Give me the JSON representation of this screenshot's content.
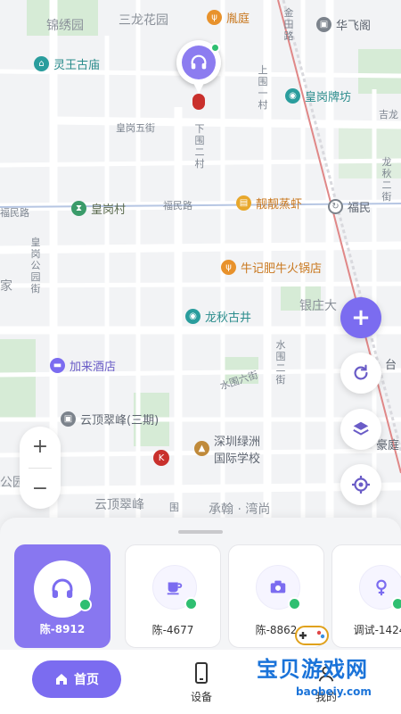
{
  "map": {
    "areas": {
      "jinxiu": "锦绣园",
      "sanlong": "三龙花园",
      "jia": "家",
      "gongyuan": "公园",
      "yinzhuang": "银庄大",
      "yunding_bottom": "云顶翠峰",
      "chenghan": "承翰 · 湾尚",
      "shantai": "台",
      "ji": "吉龙"
    },
    "roads": {
      "jinhuan": "金田路",
      "shangweiyi": "上围一村",
      "huanggang5": "皇岗五街",
      "xiawei": "下围二村",
      "fumin_left": "福民路",
      "fumin_mid": "福民路",
      "huanggang_park": "皇岗公园街",
      "longqiu": "龙秋二街",
      "shuiwei6": "水围六街",
      "shuiwei2": "水围二街",
      "wei": "围"
    },
    "pois": {
      "lingwang": "灵王古庙",
      "lu": "胤庭",
      "huafei": "华飞阁",
      "huanggang_paifang": "皇岗牌坊",
      "huanggangcun": "皇岗村",
      "liangliang": "靓靓蒸虾",
      "fumin": "福民",
      "niuji": "牛记肥牛火锅店",
      "longqiu_well": "龙秋古井",
      "jialai": "加来酒店",
      "yunding": "云顶翠峰(三期)",
      "shenzhen_school": "深圳绿洲",
      "shenzhen_school2": "国际学校",
      "haoting": "豪庭"
    }
  },
  "controls": {
    "zoom_in": "+",
    "zoom_out": "−",
    "add": "+"
  },
  "devices": [
    {
      "name": "陈-8912",
      "icon": "headphones-icon",
      "active": true
    },
    {
      "name": "陈-4677",
      "icon": "cup-icon",
      "active": false
    },
    {
      "name": "陈-8862",
      "icon": "camera-icon",
      "active": false
    },
    {
      "name": "调试-1424",
      "icon": "female-icon",
      "active": false
    }
  ],
  "nav": {
    "home": "首页",
    "device": "设备",
    "mine": "我的"
  },
  "watermark": {
    "title": "宝贝游戏网",
    "url": "baobeiy.com"
  },
  "colors": {
    "accent": "#7b6cf0",
    "online": "#2fbf71"
  }
}
